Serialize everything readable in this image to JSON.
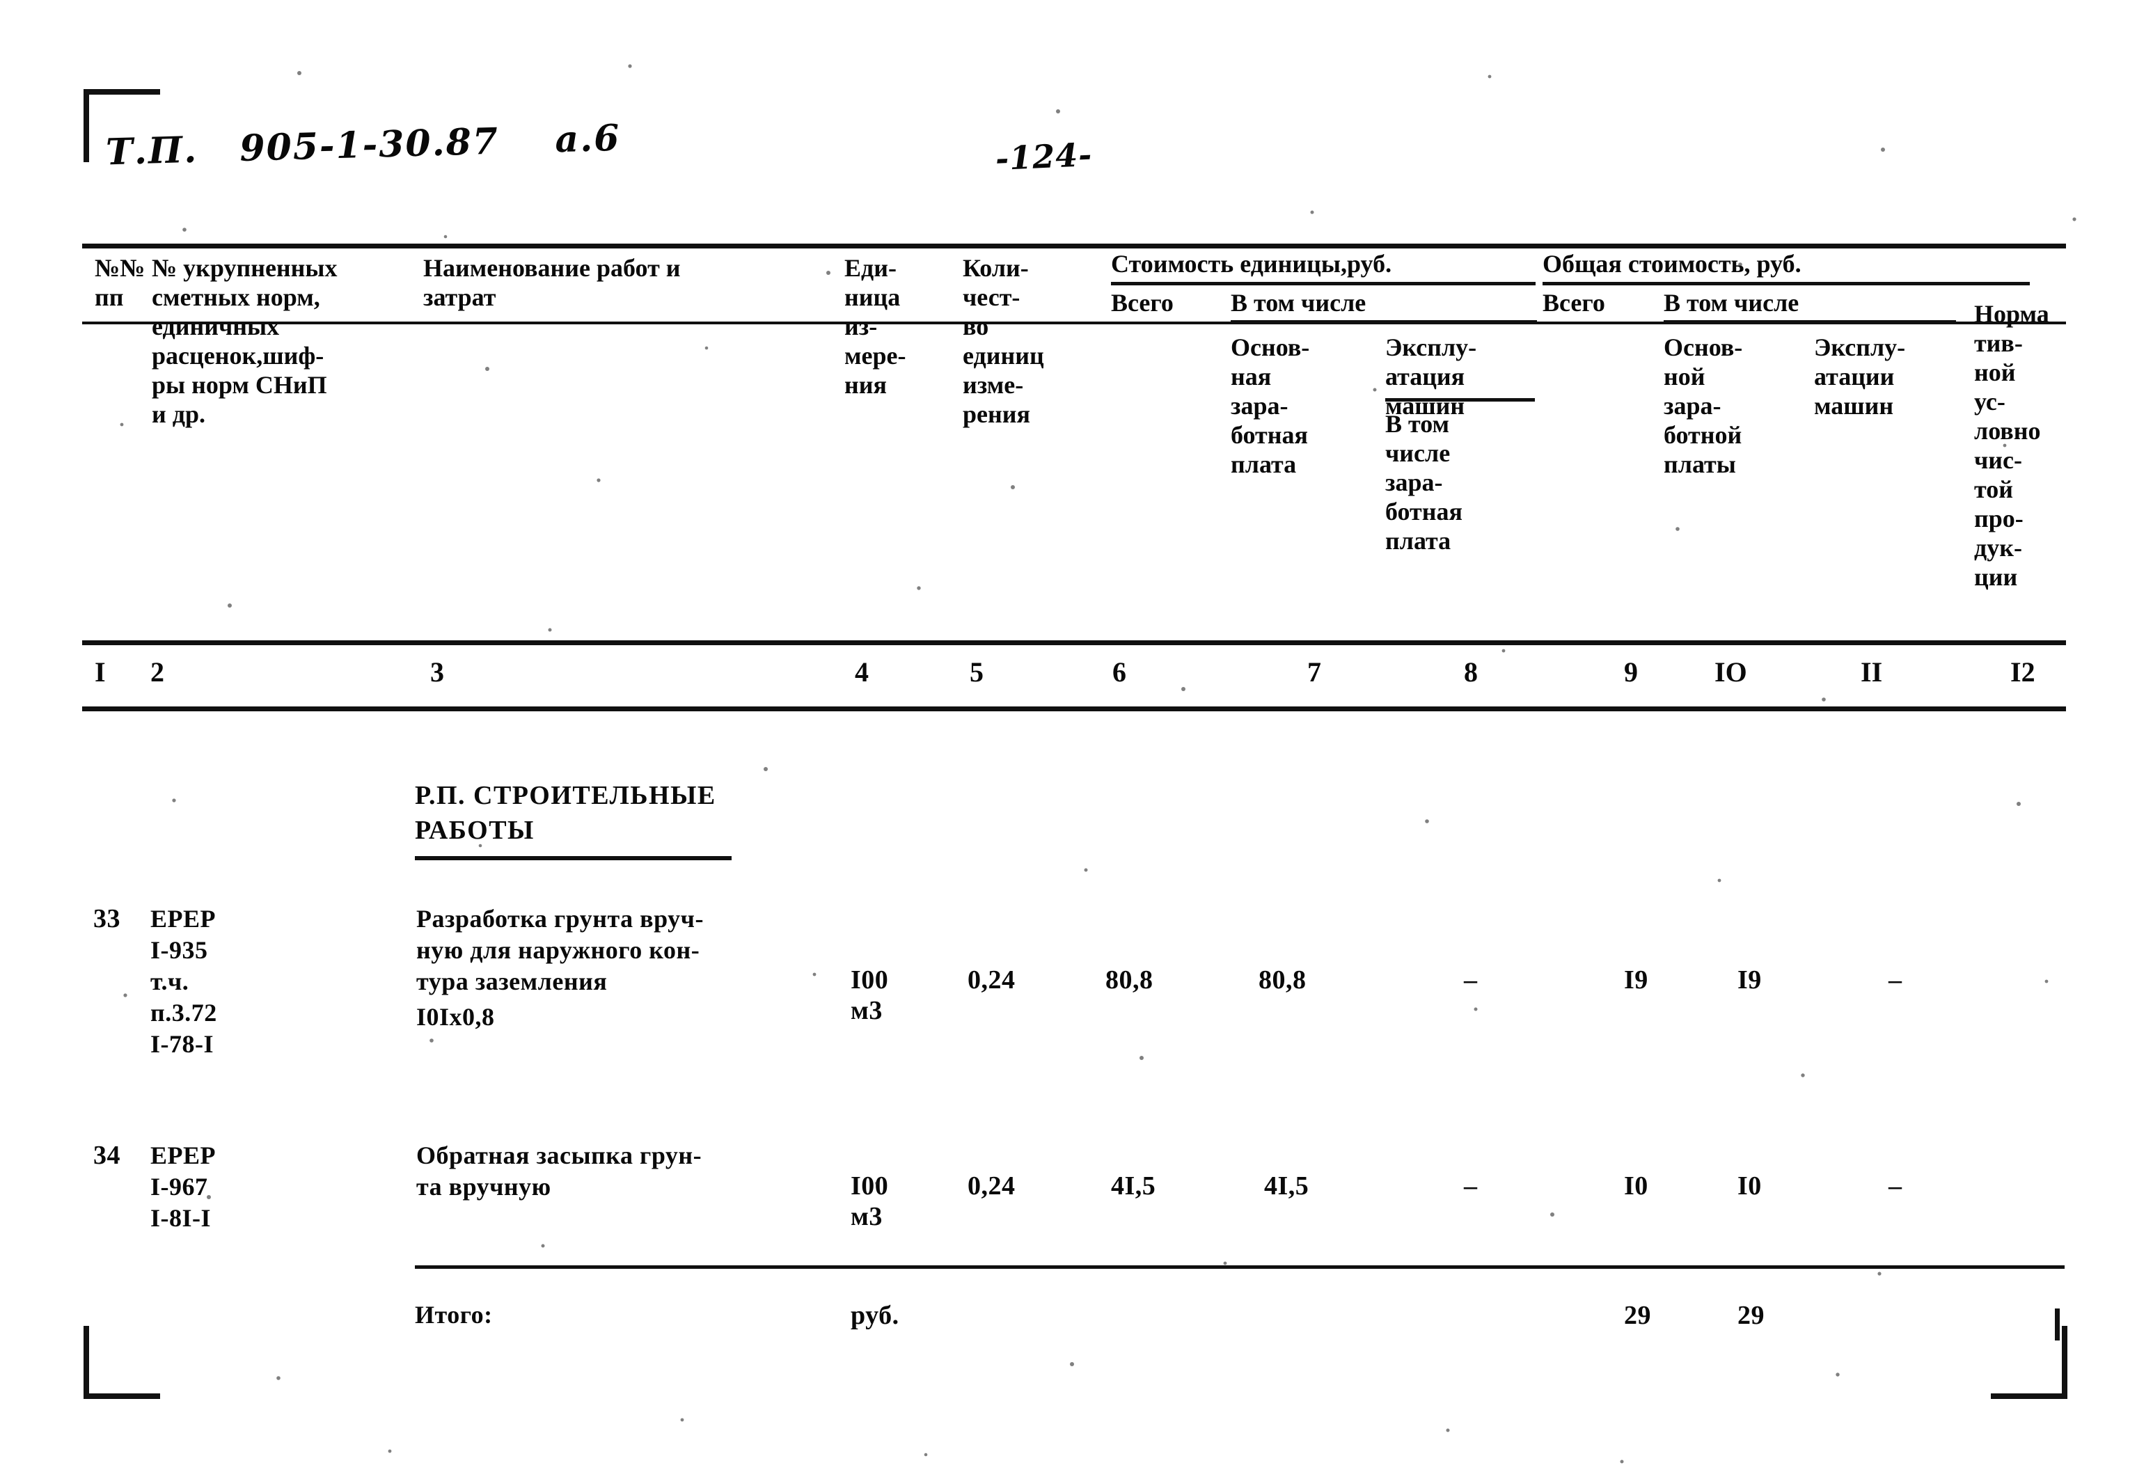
{
  "document": {
    "handwritten_code": "Т.П.   905-1-30.87    а.6",
    "page_number": "-124-"
  },
  "table": {
    "headers": {
      "col1": "№№\nпп",
      "col2": "№ укрупненных\nсметных норм,\nединичных\nрасценок,шиф-\nры норм СНиП\nи др.",
      "col3": "Наименование работ и\nзатрат",
      "col4": "Еди-\nница\nиз-\nмере-\nния",
      "col5": "Коли-\nчест-\nво\nединиц\nизме-\nрения",
      "group_unit_cost": "Стоимость единицы,руб.",
      "col6": "Всего",
      "group_incl_left": "В том числе",
      "col7": "Основ-\nная\nзара-\nботная\nплата",
      "col8_top": "Эксплу-\nатация\nмашин",
      "col8_bottom": "В том\nчисле\nзара-\nботная\nплата",
      "group_total_cost": "Общая стоимость, руб.",
      "col9": "Всего",
      "group_incl_right": "В том числе",
      "col10": "Основ-\nной\nзара-\nботной\nплаты",
      "col11": "Эксплу-\nатации\nмашин",
      "col12": "Норма\nтив-\nной\nус-\nловно\nчис-\nтой\nпро-\nдук-\nции"
    },
    "column_numbers": [
      "I",
      "2",
      "3",
      "4",
      "5",
      "6",
      "7",
      "8",
      "9",
      "IO",
      "II",
      "I2"
    ],
    "section_title": "Р.П.  СТРОИТЕЛЬНЫЕ\n      РАБОТЫ",
    "rows": [
      {
        "num": "33",
        "code": "ЕРЕР\nI-935\n т.ч.\n п.3.72\nI-78-I",
        "name": "Разработка грунта вруч-\nную для наружного кон-\nтура заземления",
        "name_extra": "I0Iх0,8",
        "unit": "I00\nм3",
        "qty": "0,24",
        "unit_total": "80,8",
        "unit_wage": "80,8",
        "unit_machine": "–",
        "total": "I9",
        "total_wage": "I9",
        "total_machine": "–",
        "nchp": ""
      },
      {
        "num": "34",
        "code": "ЕРЕР\nI-967\nI-8I-I",
        "name": "Обратная засыпка грун-\nта вручную",
        "name_extra": "",
        "unit": "I00\nм3",
        "qty": "0,24",
        "unit_total": "4I,5",
        "unit_wage": "4I,5",
        "unit_machine": "–",
        "total": "I0",
        "total_wage": "I0",
        "total_machine": "–",
        "nchp": ""
      }
    ],
    "total_row": {
      "label": "Итого:",
      "unit": "руб.",
      "total": "29",
      "total_wage": "29"
    }
  }
}
